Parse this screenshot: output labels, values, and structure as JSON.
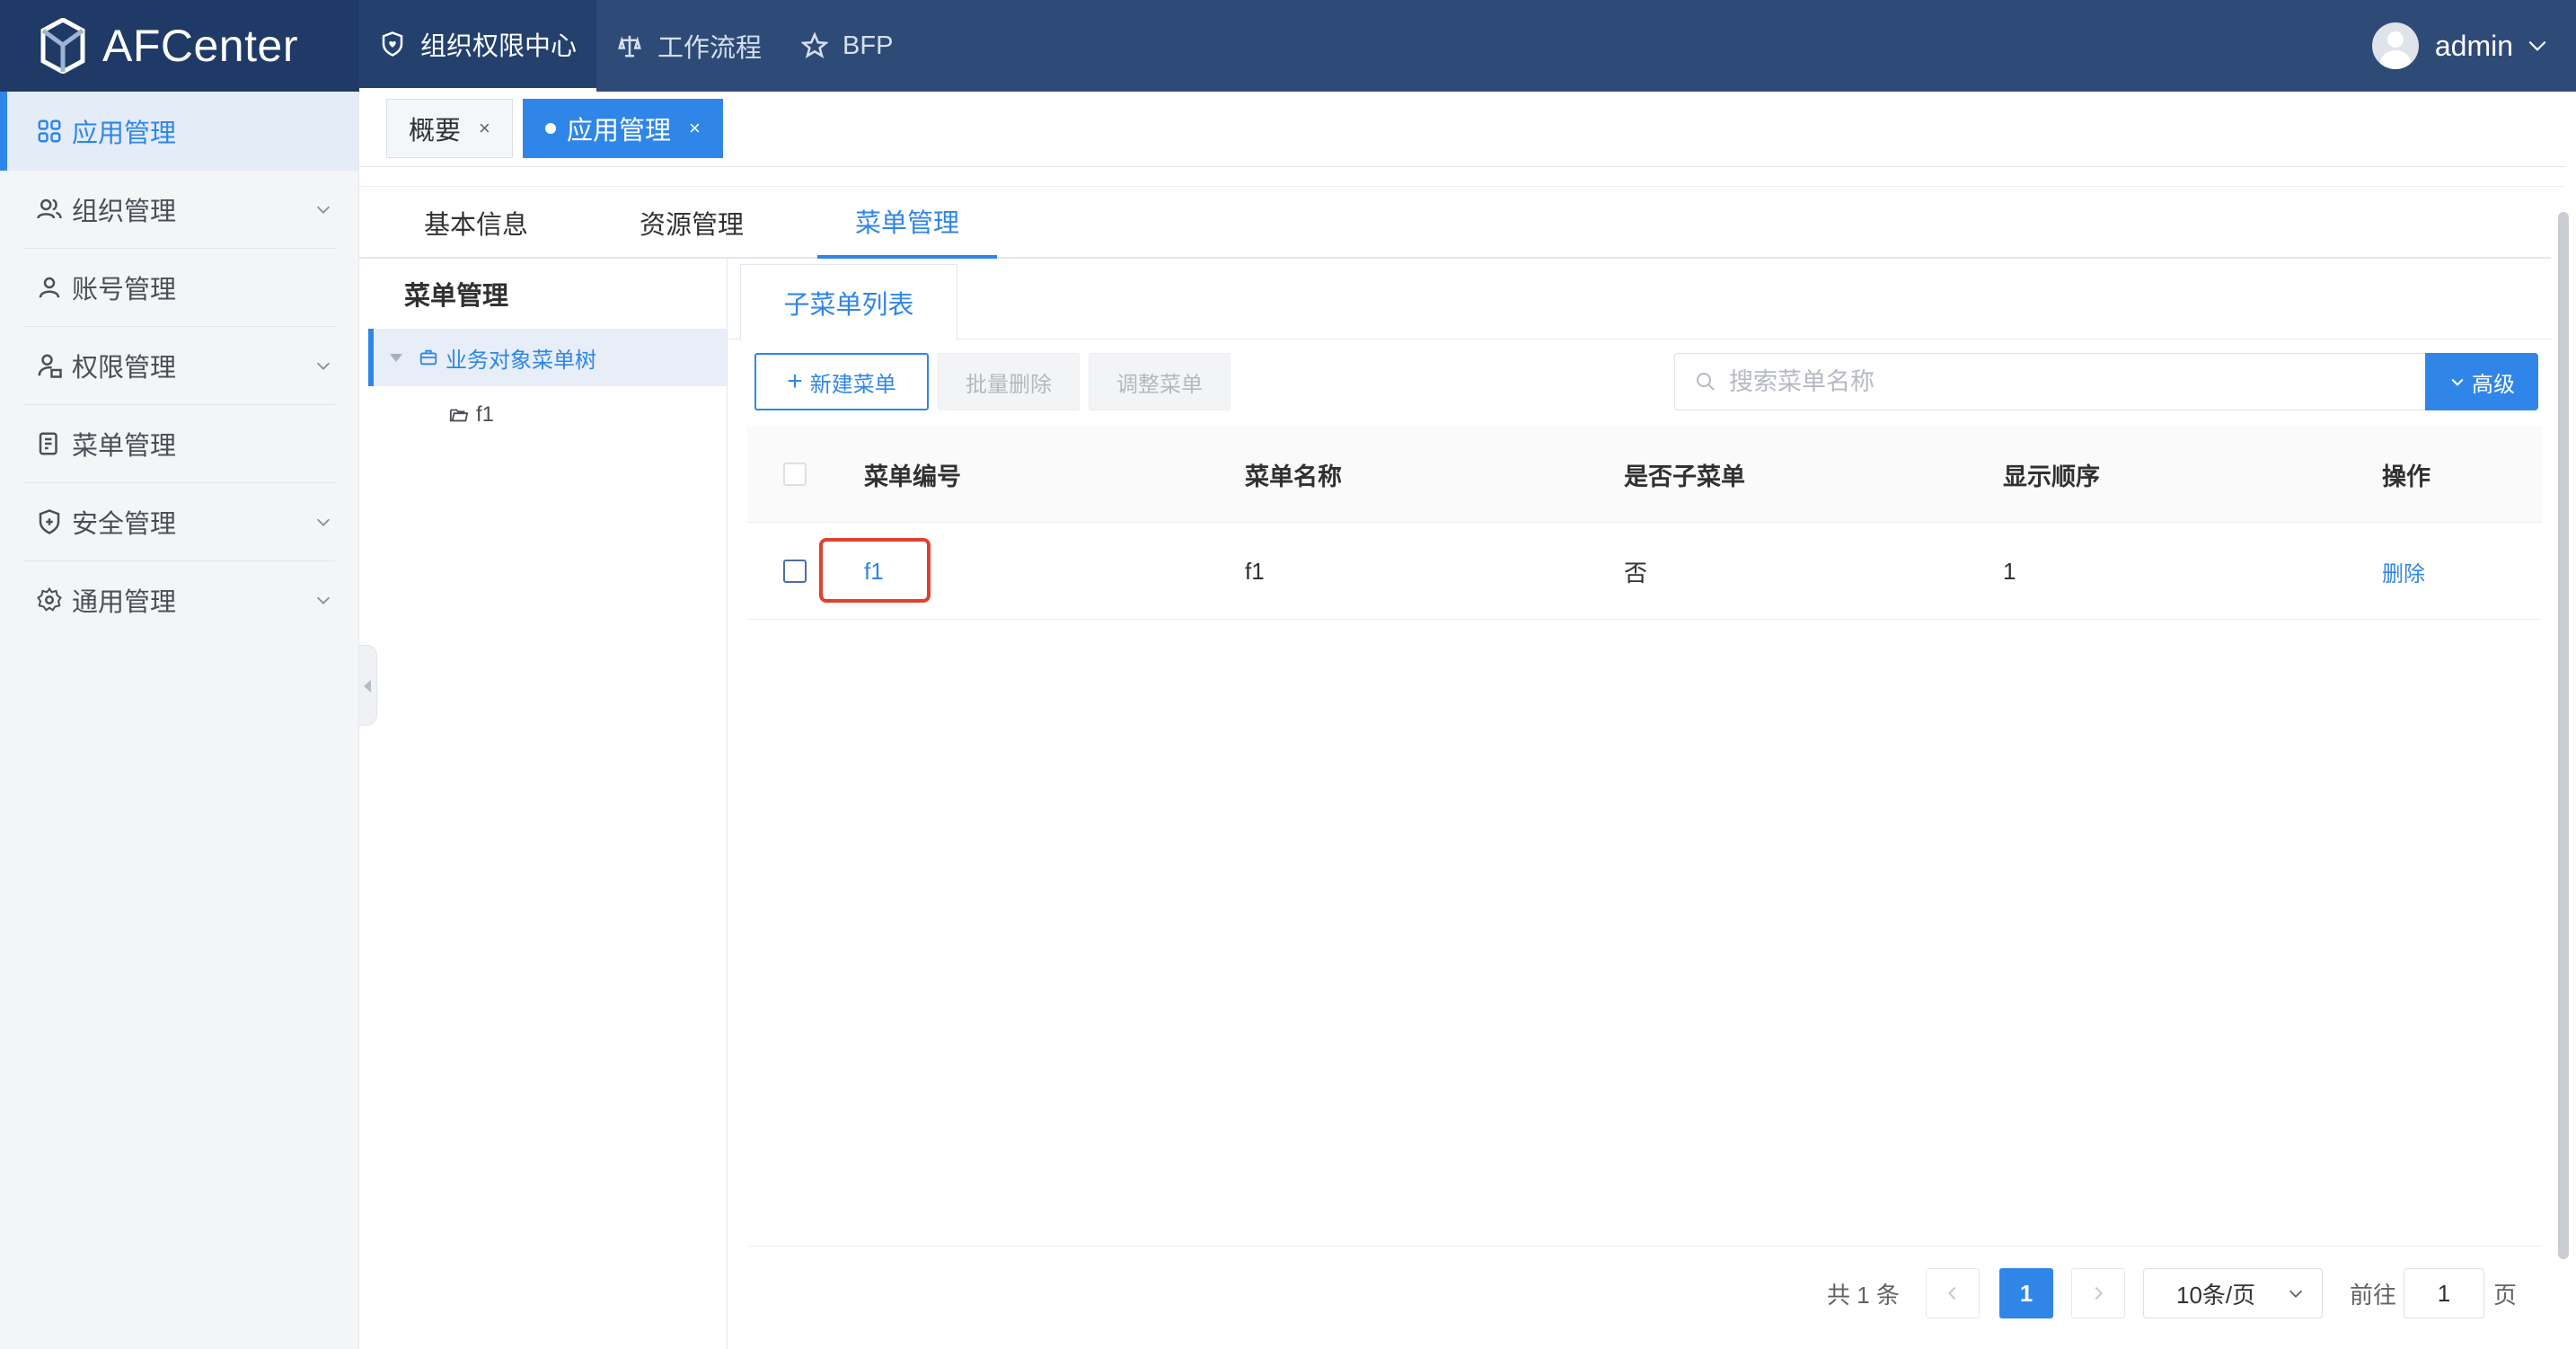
{
  "app": {
    "logo_text": "AFCenter"
  },
  "topnav": [
    {
      "label": "组织权限中心",
      "icon": "shield-heart-icon",
      "active": true
    },
    {
      "label": "工作流程",
      "icon": "scale-icon",
      "active": false
    },
    {
      "label": "BFP",
      "icon": "star-icon",
      "active": false
    }
  ],
  "user": {
    "name": "admin"
  },
  "sidebar": {
    "items": [
      {
        "label": "应用管理",
        "icon": "grid-icon",
        "active": true
      },
      {
        "label": "组织管理",
        "icon": "users-icon",
        "expandable": true
      },
      {
        "label": "账号管理",
        "icon": "user-icon"
      },
      {
        "label": "权限管理",
        "icon": "user-lock-icon",
        "expandable": true
      },
      {
        "label": "菜单管理",
        "icon": "menu-doc-icon"
      },
      {
        "label": "安全管理",
        "icon": "shield-plus-icon",
        "expandable": true
      },
      {
        "label": "通用管理",
        "icon": "gear-icon",
        "expandable": true
      }
    ]
  },
  "page_tabs": [
    {
      "label": "概要",
      "close": "×"
    },
    {
      "label": "应用管理",
      "close": "×",
      "active": true
    }
  ],
  "inner_tabs": [
    {
      "label": "基本信息"
    },
    {
      "label": "资源管理"
    },
    {
      "label": "菜单管理",
      "active": true
    }
  ],
  "tree": {
    "title": "菜单管理",
    "root": "业务对象菜单树",
    "children": [
      "f1"
    ]
  },
  "sub_tab": {
    "label": "子菜单列表"
  },
  "toolbar": {
    "new_label": "新建菜单",
    "batch_delete_label": "批量删除",
    "adjust_label": "调整菜单",
    "search_placeholder": "搜索菜单名称",
    "advanced_label": "高级"
  },
  "table": {
    "columns": [
      "菜单编号",
      "菜单名称",
      "是否子菜单",
      "显示顺序",
      "操作"
    ],
    "rows": [
      {
        "code": "f1",
        "name": "f1",
        "is_sub": "否",
        "order": "1",
        "action": "删除"
      }
    ]
  },
  "pagination": {
    "total_text": "共 1 条",
    "current_page": "1",
    "page_size": "10条/页",
    "goto_label": "前往",
    "goto_value": "1",
    "page_suffix": "页"
  },
  "colors": {
    "primary": "#2f86e8",
    "header": "#2e4b78",
    "highlight": "#e0402e"
  }
}
